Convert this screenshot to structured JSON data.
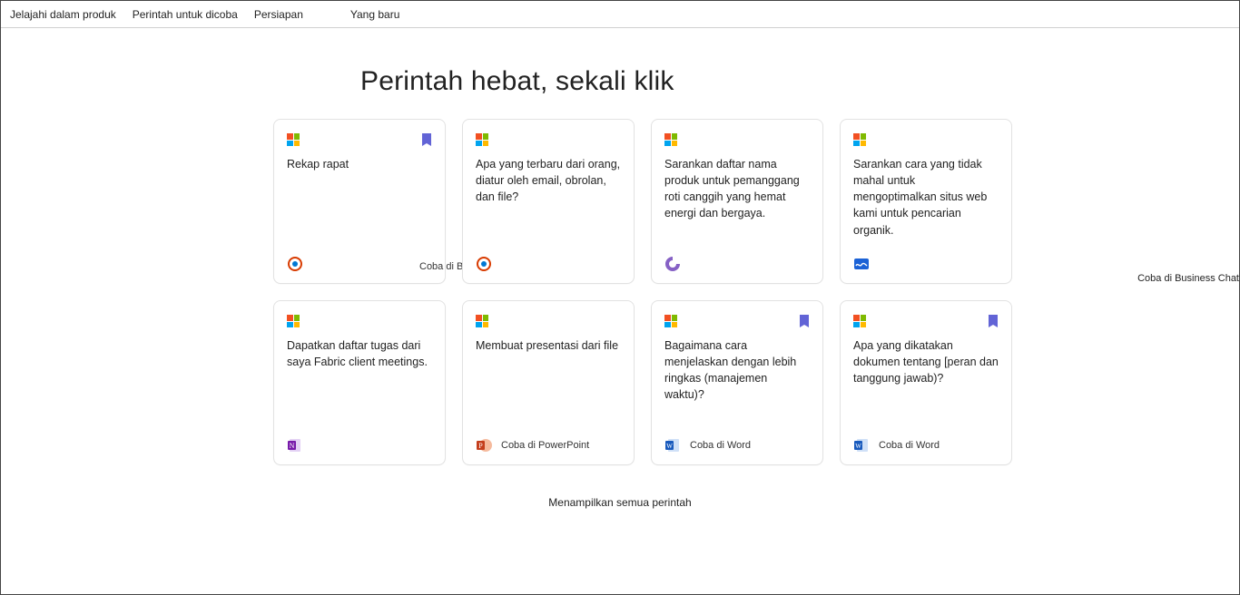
{
  "nav": {
    "explore": "Jelajahi dalam produk",
    "try": "Perintah untuk dicoba",
    "setup": "Persiapan",
    "whatsnew": "Yang baru"
  },
  "heading": "Perintah hebat, sekali klik",
  "side_label": "Coba di Business Chat",
  "show_all": "Menampilkan semua perintah",
  "cards": [
    {
      "text": "Rekap rapat",
      "cta": "Coba di Business Chat",
      "bookmarked": true,
      "app": "copilot"
    },
    {
      "text": "Apa yang terbaru dari orang, diatur oleh email, obrolan, dan file?",
      "cta": "",
      "bookmarked": false,
      "app": "copilot"
    },
    {
      "text": "Sarankan daftar nama produk untuk pemanggang roti canggih yang hemat energi dan bergaya.",
      "cta": "",
      "bookmarked": false,
      "app": "loop"
    },
    {
      "text": "Sarankan cara yang tidak mahal untuk mengoptimalkan situs web kami untuk pencarian organik.",
      "cta": "",
      "bookmarked": false,
      "app": "whiteboard"
    },
    {
      "text": "Dapatkan daftar tugas dari saya Fabric client meetings.",
      "cta": "",
      "bookmarked": false,
      "app": "onenote"
    },
    {
      "text": "Membuat presentasi dari file",
      "cta": "Coba di PowerPoint",
      "bookmarked": false,
      "app": "powerpoint"
    },
    {
      "text": "Bagaimana cara menjelaskan dengan lebih ringkas (manajemen waktu)?",
      "cta": "Coba di Word",
      "bookmarked": true,
      "app": "word"
    },
    {
      "text": "Apa yang dikatakan dokumen tentang [peran dan tanggung jawab)?",
      "cta": "Coba di Word",
      "bookmarked": true,
      "app": "word"
    }
  ]
}
